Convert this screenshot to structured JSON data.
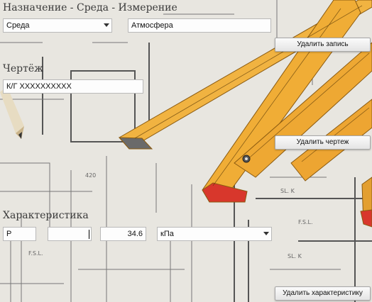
{
  "section_purpose": {
    "title": "Назначение - Среда - Измерение"
  },
  "environment": {
    "selected": "Среда",
    "value": "Атмосфера"
  },
  "buttons": {
    "delete_record": "Удалить запись",
    "delete_drawing": "Удалить чертеж",
    "delete_characteristic": "Удалить характеристику"
  },
  "drawing": {
    "title": "Чертёж",
    "number": "К/Г XXXXXXXXXX"
  },
  "characteristic": {
    "title": "Характеристика",
    "symbol": "P",
    "extra": "",
    "value": "34.6",
    "unit": "кПа"
  },
  "background": {
    "description_icon": "blueprint-rulers-icon",
    "paper_color": "#e9e7e1",
    "ruler_color": "#f1b341",
    "line_color": "#4a4a4a"
  }
}
